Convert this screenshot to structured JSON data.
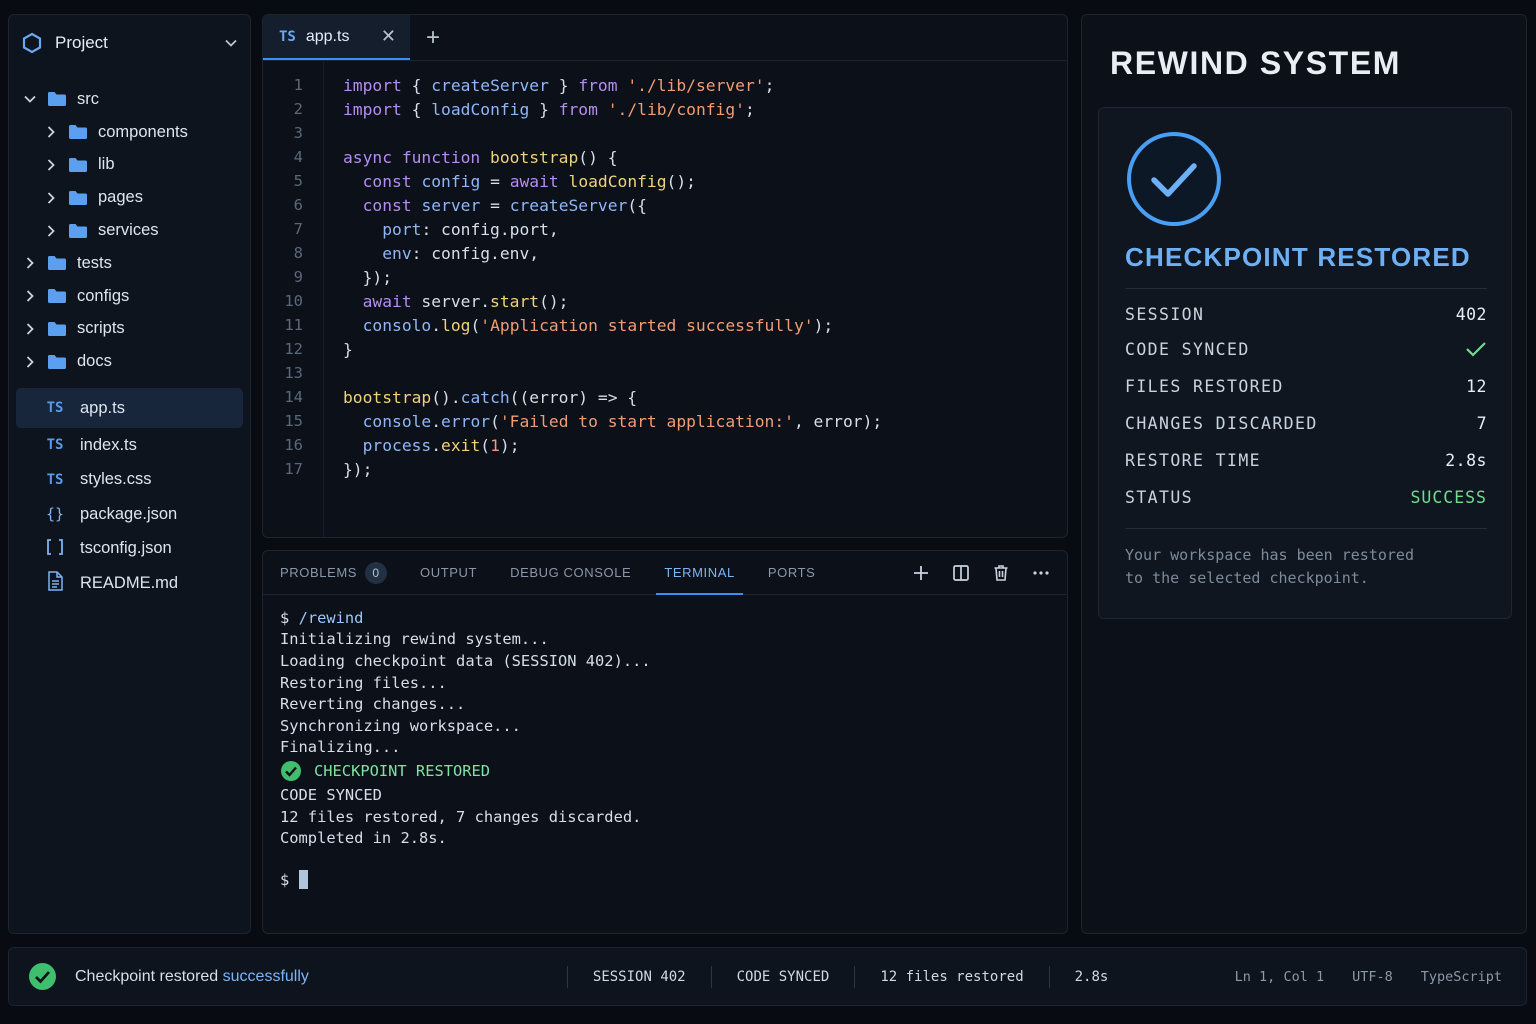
{
  "sidebar": {
    "title": "Project",
    "tree": [
      {
        "label": "src",
        "expanded": true
      },
      {
        "label": "components"
      },
      {
        "label": "lib"
      },
      {
        "label": "pages"
      },
      {
        "label": "services"
      },
      {
        "label": "tests"
      },
      {
        "label": "configs"
      },
      {
        "label": "scripts"
      },
      {
        "label": "docs"
      }
    ],
    "files": [
      {
        "icon": "TS",
        "label": "app.ts",
        "active": true
      },
      {
        "icon": "TS",
        "label": "index.ts"
      },
      {
        "icon": "TS",
        "label": "styles.css"
      },
      {
        "icon": "{}",
        "label": "package.json"
      },
      {
        "icon": "[]",
        "label": "tsconfig.json"
      },
      {
        "icon": "doc",
        "label": "README.md"
      }
    ]
  },
  "editor": {
    "tab": {
      "icon": "TS",
      "label": "app.ts"
    },
    "line_numbers": [
      "1",
      "2",
      "3",
      "4",
      "5",
      "6",
      "7",
      "8",
      "9",
      "10",
      "11",
      "12",
      "13",
      "14",
      "15",
      "16",
      "17"
    ]
  },
  "terminal": {
    "tabs": [
      "PROBLEMS",
      "OUTPUT",
      "DEBUG CONSOLE",
      "TERMINAL",
      "PORTS"
    ],
    "problems_count": "0",
    "active_tab": "TERMINAL",
    "prompt": "$",
    "command": "/rewind",
    "lines": [
      "Initializing rewind system...",
      "Loading checkpoint data (SESSION 402)...",
      "Restoring files...",
      "Reverting changes...",
      "Synchronizing workspace...",
      "Finalizing..."
    ],
    "success_line": "CHECKPOINT RESTORED",
    "after_lines": [
      "CODE SYNCED",
      "12 files restored, 7 changes discarded.",
      "Completed in 2.8s."
    ]
  },
  "rewind": {
    "title": "REWIND SYSTEM",
    "heading": "CHECKPOINT RESTORED",
    "rows": [
      {
        "label": "SESSION",
        "value": "402"
      },
      {
        "label": "CODE SYNCED",
        "value": "✓"
      },
      {
        "label": "FILES RESTORED",
        "value": "12"
      },
      {
        "label": "CHANGES DISCARDED",
        "value": "7"
      },
      {
        "label": "RESTORE TIME",
        "value": "2.8s"
      },
      {
        "label": "STATUS",
        "value": "SUCCESS"
      }
    ],
    "note_line1": "Your workspace has been restored",
    "note_line2": "to the selected checkpoint."
  },
  "statusbar": {
    "message_prefix": "Checkpoint restored ",
    "message_highlight": "successfully",
    "items": [
      "SESSION 402",
      "CODE SYNCED",
      "12 files restored",
      "2.8s"
    ],
    "position": "Ln 1, Col 1",
    "encoding": "UTF-8",
    "language": "TypeScript"
  },
  "colors": {
    "accent": "#3d8ef0",
    "success": "#6fdc8f",
    "background": "#080c12"
  }
}
